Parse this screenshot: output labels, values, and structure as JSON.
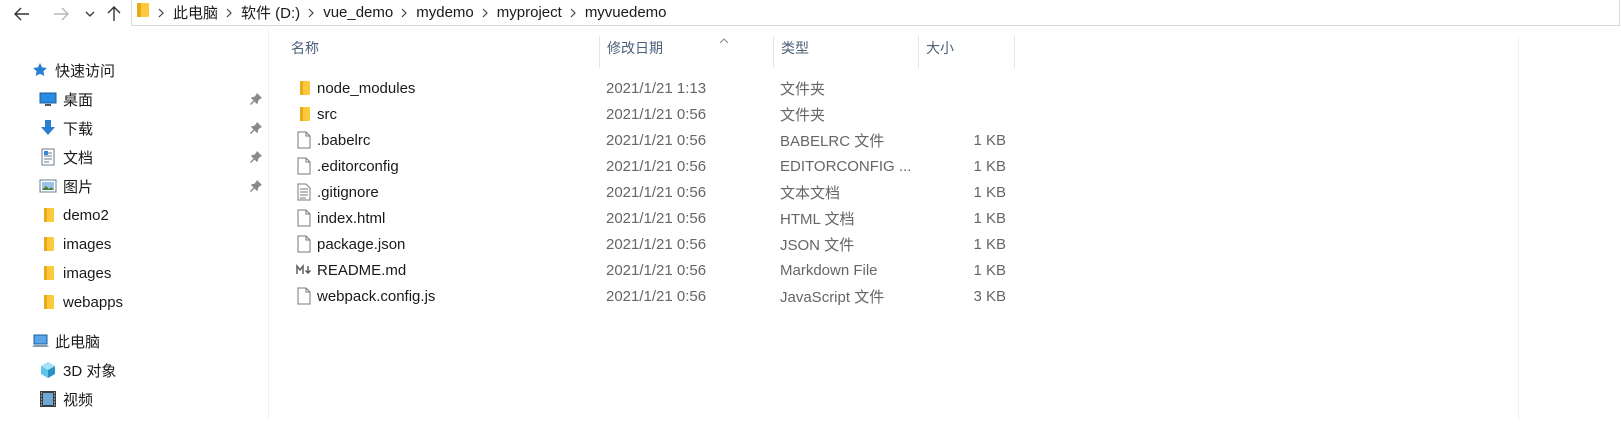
{
  "nav": {
    "back_icon": "arrow-left-icon",
    "forward_icon": "arrow-right-icon",
    "recent_icon": "chevron-down-icon",
    "up_icon": "arrow-up-icon"
  },
  "breadcrumb": [
    "此电脑",
    "软件 (D:)",
    "vue_demo",
    "mydemo",
    "myproject",
    "myvuedemo"
  ],
  "sidebar": {
    "quick_access": "快速访问",
    "pinned": [
      {
        "label": "桌面",
        "icon": "desktop-icon"
      },
      {
        "label": "下载",
        "icon": "download-icon"
      },
      {
        "label": "文档",
        "icon": "document-icon"
      },
      {
        "label": "图片",
        "icon": "pictures-icon"
      }
    ],
    "folders": [
      "demo2",
      "images",
      "images",
      "webapps"
    ],
    "this_pc": "此电脑",
    "pc_items": [
      {
        "label": "3D 对象",
        "icon": "3d-objects-icon"
      },
      {
        "label": "视频",
        "icon": "videos-icon"
      }
    ]
  },
  "columns": {
    "name": "名称",
    "modified": "修改日期",
    "type": "类型",
    "size": "大小"
  },
  "files": [
    {
      "name": "node_modules",
      "modified": "2021/1/21 1:13",
      "type": "文件夹",
      "size": "",
      "icon": "folder"
    },
    {
      "name": "src",
      "modified": "2021/1/21 0:56",
      "type": "文件夹",
      "size": "",
      "icon": "folder"
    },
    {
      "name": ".babelrc",
      "modified": "2021/1/21 0:56",
      "type": "BABELRC 文件",
      "size": "1 KB",
      "icon": "file"
    },
    {
      "name": ".editorconfig",
      "modified": "2021/1/21 0:56",
      "type": "EDITORCONFIG ...",
      "size": "1 KB",
      "icon": "file"
    },
    {
      "name": ".gitignore",
      "modified": "2021/1/21 0:56",
      "type": "文本文档",
      "size": "1 KB",
      "icon": "text"
    },
    {
      "name": "index.html",
      "modified": "2021/1/21 0:56",
      "type": "HTML 文档",
      "size": "1 KB",
      "icon": "file"
    },
    {
      "name": "package.json",
      "modified": "2021/1/21 0:56",
      "type": "JSON 文件",
      "size": "1 KB",
      "icon": "file"
    },
    {
      "name": "README.md",
      "modified": "2021/1/21 0:56",
      "type": "Markdown File",
      "size": "1 KB",
      "icon": "markdown"
    },
    {
      "name": "webpack.config.js",
      "modified": "2021/1/21 0:56",
      "type": "JavaScript 文件",
      "size": "3 KB",
      "icon": "file"
    }
  ],
  "colors": {
    "folder": "#ffc83d",
    "folder_dark": "#e8a91c",
    "accent": "#0078d7",
    "header_text": "#4c607a"
  }
}
